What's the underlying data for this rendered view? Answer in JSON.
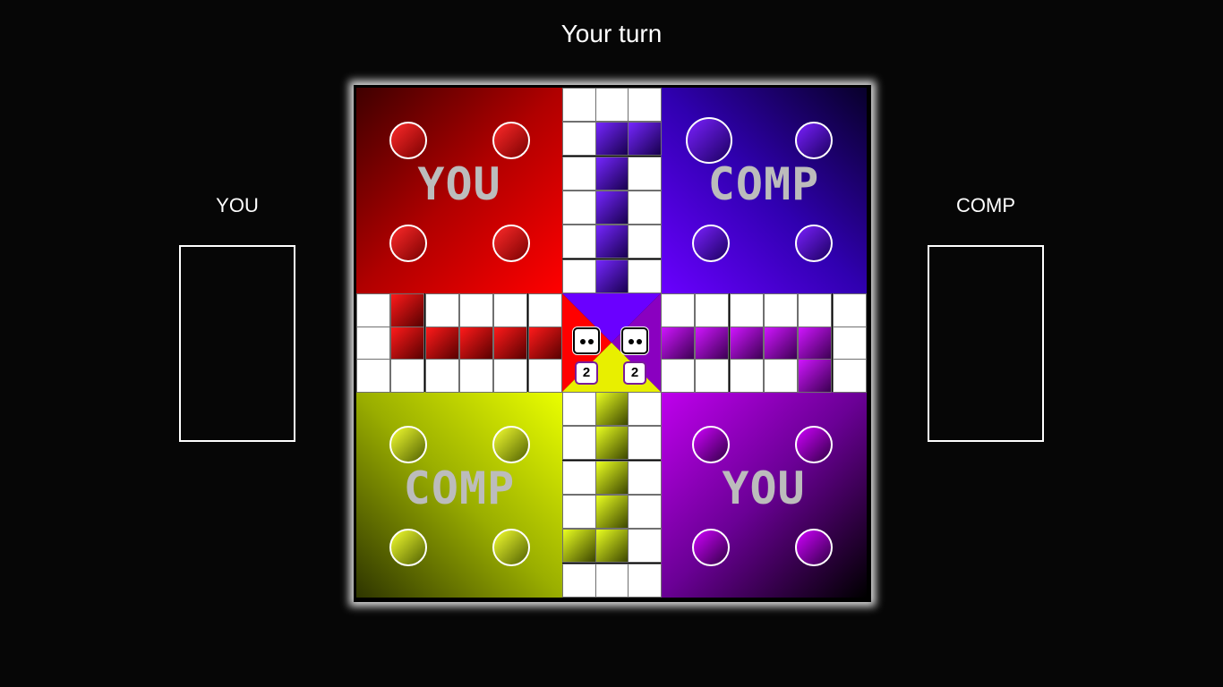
{
  "status": {
    "turn_text": "Your turn"
  },
  "players": {
    "left": {
      "label": "YOU"
    },
    "right": {
      "label": "COMP"
    }
  },
  "board": {
    "homes": {
      "red": {
        "label": "YOU",
        "color": "#cc0000"
      },
      "blue": {
        "label": "COMP",
        "color": "#4a00d8"
      },
      "yellow": {
        "label": "COMP",
        "color": "#c8dd00"
      },
      "purple": {
        "label": "YOU",
        "color": "#9200c8"
      }
    },
    "center": {
      "dice": [
        {
          "value": 2,
          "count_label": "2"
        },
        {
          "value": 2,
          "count_label": "2"
        }
      ],
      "triangle_colors": {
        "left": "#ff0000",
        "top": "#6a00ff",
        "right": "#8a00c0",
        "bottom": "#e8ef00"
      }
    }
  }
}
